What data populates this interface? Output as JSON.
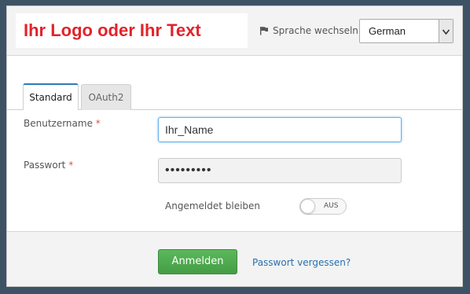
{
  "header": {
    "logo_text": "Ihr Logo oder Ihr Text",
    "language_label": "Sprache wechseln:",
    "language_selected": "German"
  },
  "tabs": [
    {
      "label": "Standard",
      "active": true
    },
    {
      "label": "OAuth2",
      "active": false
    }
  ],
  "form": {
    "username_label": "Benutzername",
    "username_value": "Ihr_Name",
    "password_label": "Passwort",
    "password_value": "•••••••••",
    "required_mark": "*",
    "remember_label": "Angemeldet bleiben",
    "remember_toggle_text": "AUS"
  },
  "footer": {
    "login_button": "Anmelden",
    "forgot_link": "Passwort vergessen?"
  },
  "colors": {
    "background": "#3e5266",
    "logo_red": "#e2232a",
    "accent_blue": "#2d7bb6",
    "login_green": "#5cb85c",
    "link_blue": "#2a6fb0"
  },
  "icons": {
    "language": "flag-icon",
    "select_arrow": "chevron-down-icon"
  }
}
